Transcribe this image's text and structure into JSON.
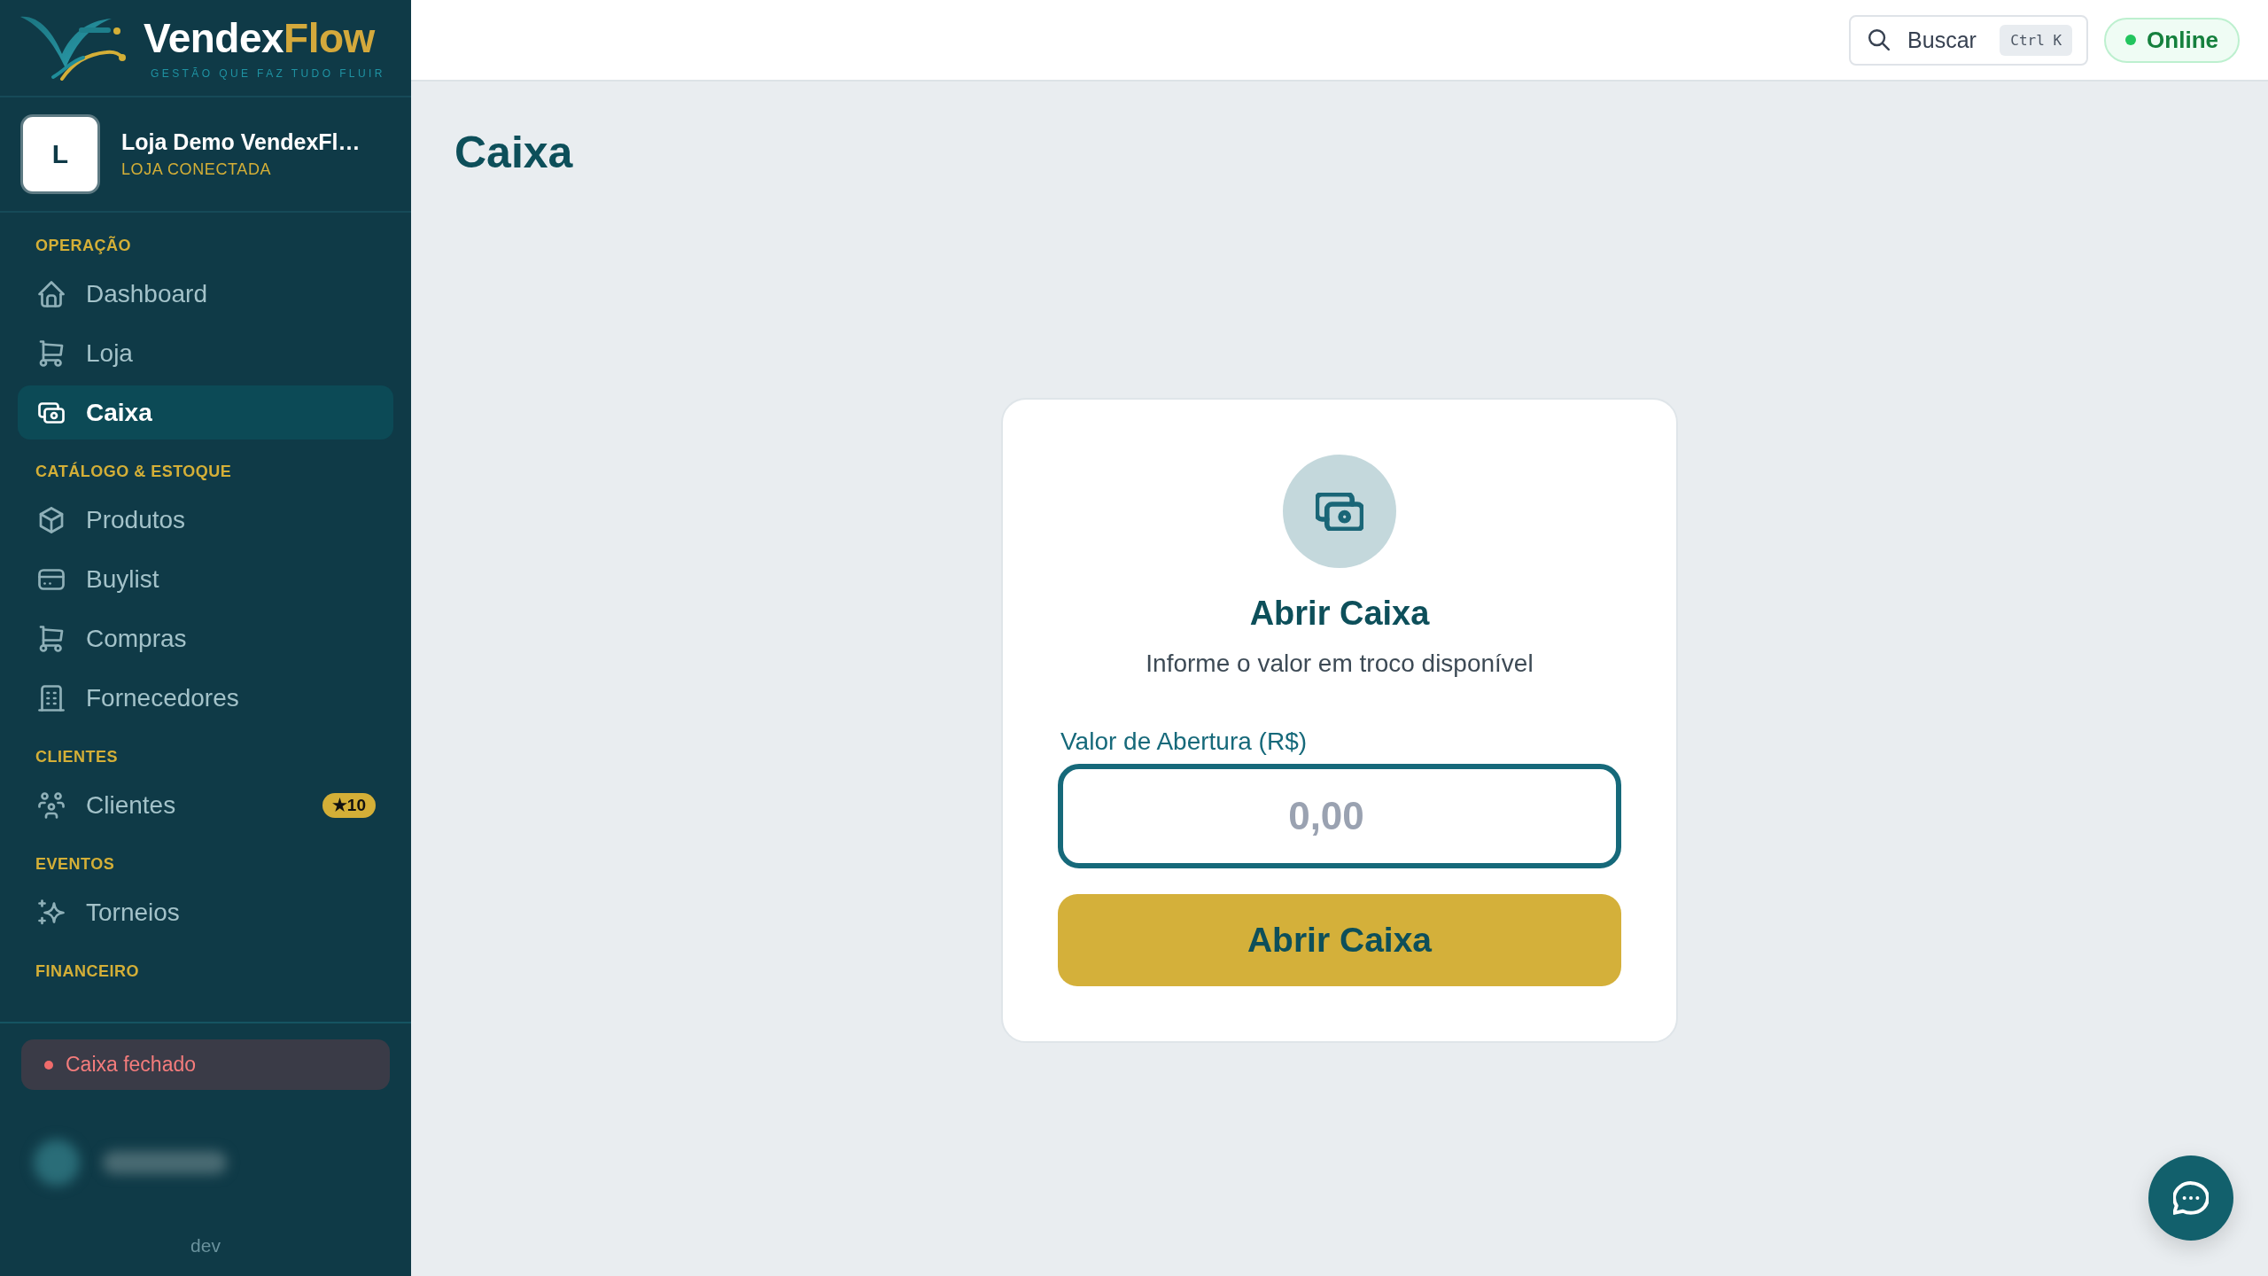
{
  "logo": {
    "name_start": "Vendex",
    "name_end": "Flow",
    "tagline": "GESTÃO QUE FAZ TUDO FLUIR"
  },
  "store": {
    "initial": "L",
    "name": "Loja Demo VendexFl…",
    "status": "LOJA CONECTADA"
  },
  "sidebar": {
    "sections": [
      {
        "title": "OPERAÇÃO",
        "items": [
          {
            "label": "Dashboard",
            "selected": false
          },
          {
            "label": "Loja",
            "selected": false
          },
          {
            "label": "Caixa",
            "selected": true
          }
        ]
      },
      {
        "title": "CATÁLOGO & ESTOQUE",
        "items": [
          {
            "label": "Produtos",
            "selected": false
          },
          {
            "label": "Buylist",
            "selected": false
          },
          {
            "label": "Compras",
            "selected": false
          },
          {
            "label": "Fornecedores",
            "selected": false
          }
        ]
      },
      {
        "title": "CLIENTES",
        "items": [
          {
            "label": "Clientes",
            "selected": false,
            "badge": "★10"
          }
        ]
      },
      {
        "title": "EVENTOS",
        "items": [
          {
            "label": "Torneios",
            "selected": false
          }
        ]
      },
      {
        "title": "FINANCEIRO"
      }
    ]
  },
  "cash_status": {
    "label": "Caixa fechado",
    "open": false
  },
  "environment": "dev",
  "topbar": {
    "search": {
      "label": "Buscar",
      "shortcut": "Ctrl K"
    },
    "connection": {
      "label": "Online",
      "online": true
    }
  },
  "page": {
    "title": "Caixa"
  },
  "open_register": {
    "title": "Abrir Caixa",
    "subtitle": "Informe o valor em troco disponível",
    "field": {
      "label": "Valor de Abertura (R$)",
      "placeholder": "0,00"
    },
    "button": "Abrir Caixa"
  }
}
